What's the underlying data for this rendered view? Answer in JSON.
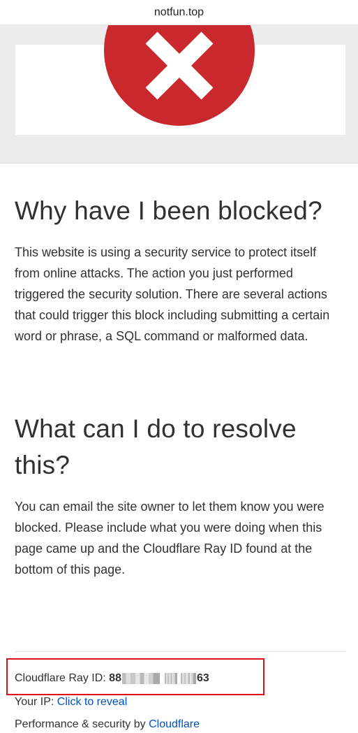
{
  "browser": {
    "domain": "notfun.top"
  },
  "hero": {
    "icon": "error-x-icon",
    "icon_color": "#c9282d"
  },
  "main": {
    "blocked_heading": "Why have I been blocked?",
    "blocked_text": "This website is using a security service to protect itself from online attacks. The action you just performed triggered the security solution. There are several actions that could trigger this block including submitting a certain word or phrase, a SQL command or malformed data.",
    "resolve_heading": "What can I do to resolve this?",
    "resolve_text": "You can email the site owner to let them know you were blocked. Please include what you were doing when this page came up and the Cloudflare Ray ID found at the bottom of this page."
  },
  "footer": {
    "ray_label": "Cloudflare Ray ID: ",
    "ray_prefix": "88",
    "ray_suffix": "63",
    "ip_label": "Your IP: ",
    "ip_link": "Click to reveal",
    "perf_label": "Performance & security by ",
    "perf_link": "Cloudflare"
  },
  "colors": {
    "link": "#0051c3",
    "highlight": "#e0101a"
  }
}
